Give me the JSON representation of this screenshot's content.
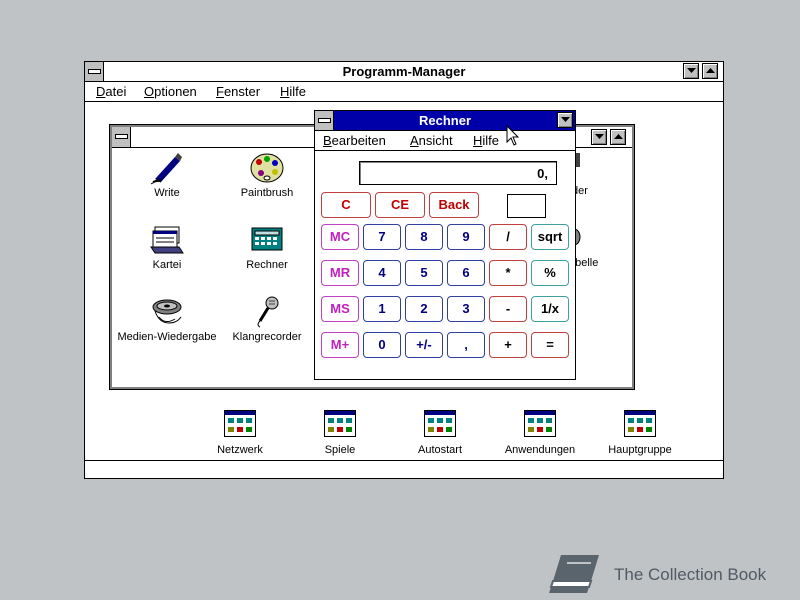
{
  "program_manager": {
    "title": "Programm-Manager",
    "menu": [
      "Datei",
      "Optionen",
      "Fenster",
      "Hilfe"
    ]
  },
  "zubehoer_group": {
    "title": "",
    "icons": [
      {
        "label": "Write",
        "icon": "write-pen-icon"
      },
      {
        "label": "Paintbrush",
        "icon": "paint-palette-icon"
      },
      {
        "label": "Kartei",
        "icon": "card-file-icon"
      },
      {
        "label": "Rechner",
        "icon": "calculator-icon"
      },
      {
        "label": "Medien-Wiedergabe",
        "icon": "media-player-reel-icon"
      },
      {
        "label": "Klangrecorder",
        "icon": "microphone-icon"
      },
      {
        "label": "der",
        "icon": "partially-hidden-icon"
      },
      {
        "label": "abelle",
        "icon": "partially-hidden-icon"
      }
    ]
  },
  "group_icons": [
    {
      "label": "Netzwerk",
      "icon": "program-group-icon"
    },
    {
      "label": "Spiele",
      "icon": "program-group-icon"
    },
    {
      "label": "Autostart",
      "icon": "program-group-icon"
    },
    {
      "label": "Anwendungen",
      "icon": "program-group-icon"
    },
    {
      "label": "Hauptgruppe",
      "icon": "program-group-icon"
    }
  ],
  "calculator": {
    "title": "Rechner",
    "menu": [
      "Bearbeiten",
      "Ansicht",
      "Hilfe"
    ],
    "display": "0,",
    "top_keys": [
      "C",
      "CE",
      "Back"
    ],
    "rows": [
      [
        "MC",
        "7",
        "8",
        "9",
        "/",
        "sqrt"
      ],
      [
        "MR",
        "4",
        "5",
        "6",
        "*",
        "%"
      ],
      [
        "MS",
        "1",
        "2",
        "3",
        "-",
        "1/x"
      ],
      [
        "M+",
        "0",
        "+/-",
        ",",
        "+",
        "="
      ]
    ]
  },
  "colors": {
    "desktop": "#c0c3c6",
    "active_title": "#0000a8",
    "key_red": "#c00000",
    "key_blue": "#000080",
    "key_magenta": "#c020c0"
  },
  "watermark": {
    "text": "The Collection Book",
    "icon": "book-icon"
  }
}
